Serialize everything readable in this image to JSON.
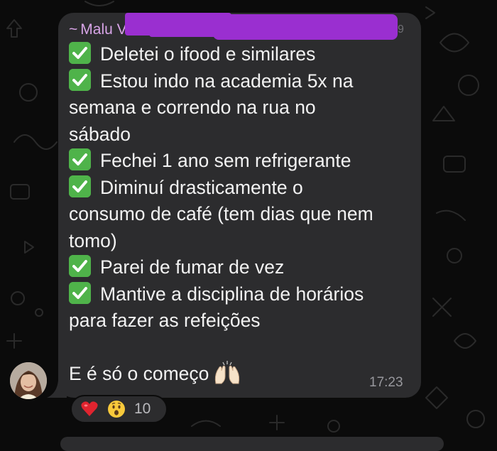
{
  "message": {
    "sender_prefix": "~",
    "sender_name": "Malu V",
    "lines": [
      {
        "check": true,
        "text": "Deletei o ifood e similares"
      },
      {
        "check": true,
        "text": "Estou indo na academia 5x na"
      },
      {
        "check": false,
        "text": "semana e correndo na rua no"
      },
      {
        "check": false,
        "text": "sábado"
      },
      {
        "check": true,
        "text": "Fechei 1 ano sem refrigerante"
      },
      {
        "check": true,
        "text": "Diminuí drasticamente o"
      },
      {
        "check": false,
        "text": "consumo de café (tem dias que nem"
      },
      {
        "check": false,
        "text": "tomo)"
      },
      {
        "check": true,
        "text": "Parei de fumar de vez"
      },
      {
        "check": true,
        "text": "Mantive a disciplina de horários"
      },
      {
        "check": false,
        "text": "para fazer as refeições"
      },
      {
        "check": false,
        "text": ""
      },
      {
        "check": false,
        "text": "E é só o começo",
        "emoji": "raising-hands"
      }
    ],
    "time": "17:23",
    "check_icon": "white-heavy-check-mark-icon",
    "colors": {
      "bubble": "#2c2c2e",
      "sender": "#d7a4e6",
      "text": "#f2f2f2",
      "check_green": "#4fb34a",
      "redaction": "#9a2fd0"
    }
  },
  "reactions": {
    "items": [
      {
        "icon": "red-heart-icon"
      },
      {
        "icon": "surprised-face-icon"
      }
    ],
    "count": "10"
  }
}
